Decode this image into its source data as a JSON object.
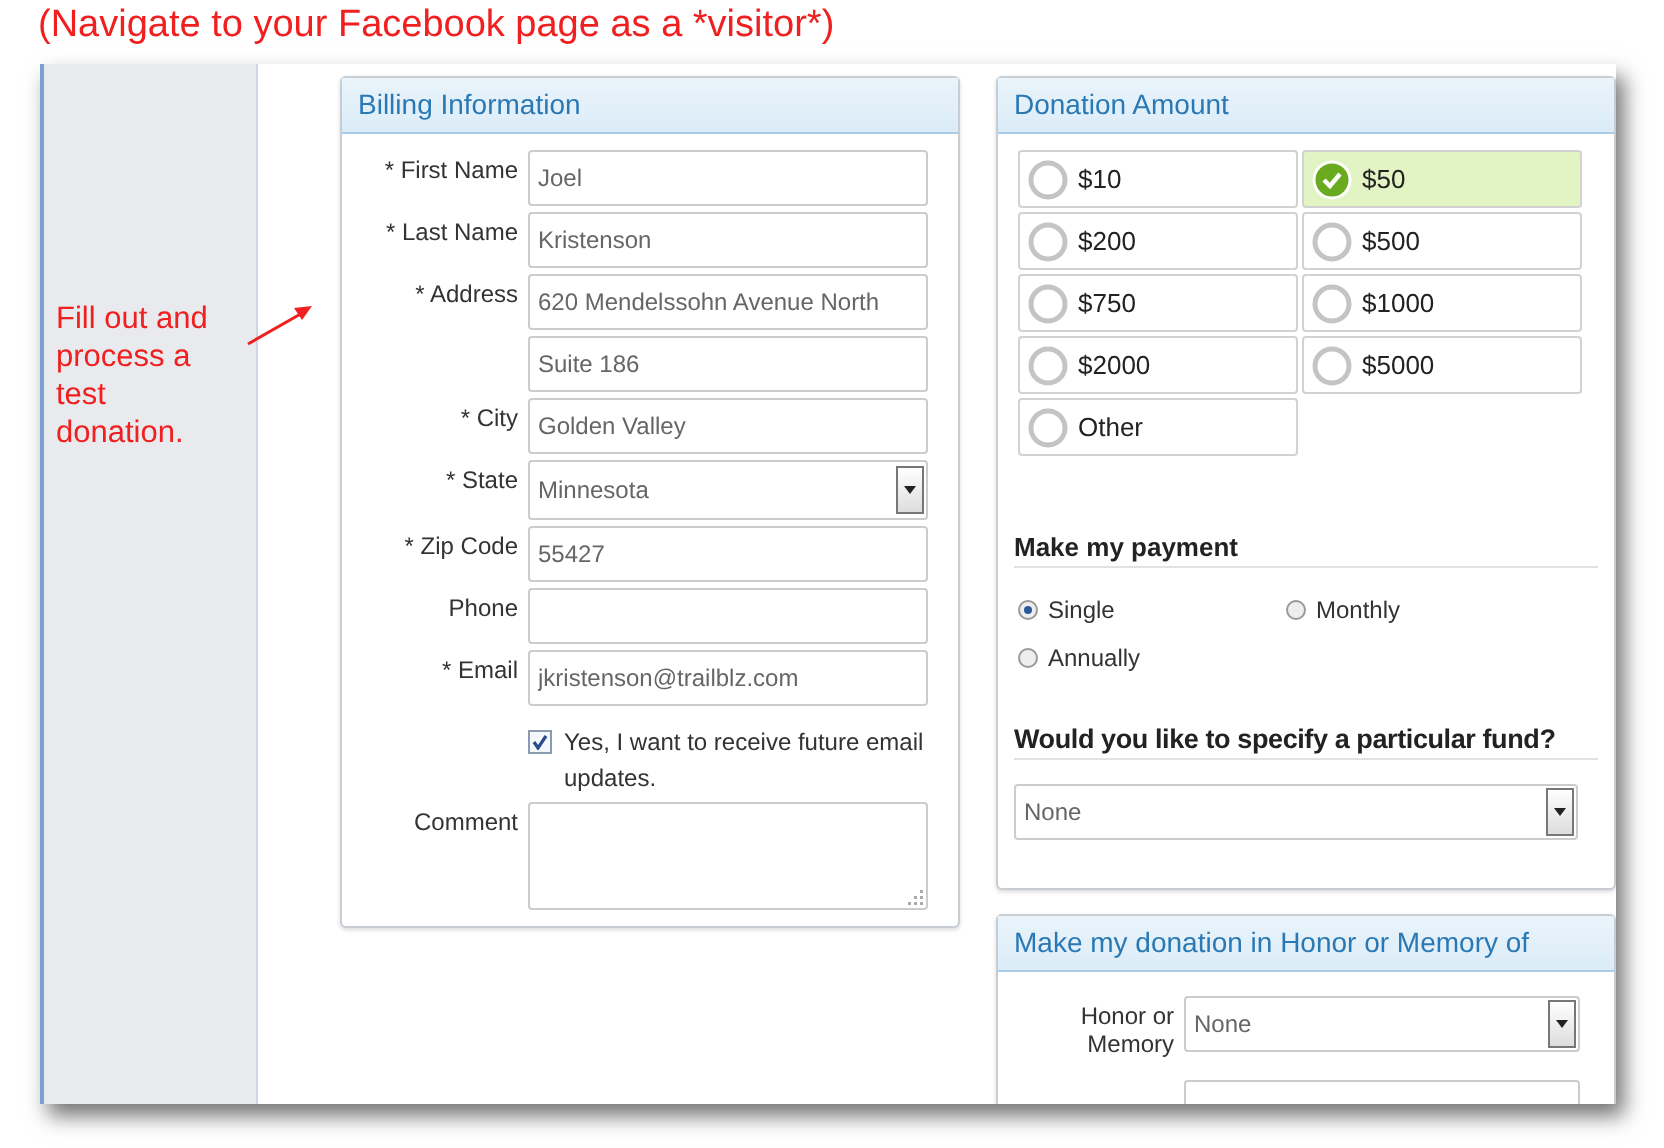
{
  "caption": "(Navigate to your Facebook page as a *visitor*)",
  "annotation": {
    "text": "Fill out and process a test donation."
  },
  "billing": {
    "title": "Billing Information",
    "fields": [
      {
        "label": "* First Name",
        "kind": "text",
        "value": "Joel"
      },
      {
        "label": "* Last Name",
        "kind": "text",
        "value": "Kristenson"
      },
      {
        "label": "* Address",
        "kind": "text",
        "value": "620 Mendelssohn Avenue North"
      },
      {
        "kind": "text",
        "value": "Suite 186"
      },
      {
        "label": "* City",
        "kind": "text",
        "value": "Golden Valley"
      },
      {
        "label": "* State",
        "kind": "select",
        "value": "Minnesota"
      },
      {
        "label": "* Zip Code",
        "kind": "text",
        "value": "55427"
      },
      {
        "label": "Phone",
        "kind": "text"
      },
      {
        "label": "* Email",
        "kind": "text",
        "value": "jkristenson@trailblz.com"
      }
    ],
    "updates": {
      "label": "Yes, I want to receive future email updates.",
      "checked": true
    },
    "comment": {
      "label": "Comment"
    }
  },
  "donation": {
    "title": "Donation Amount",
    "amounts": [
      {
        "label": "$10",
        "selected": false
      },
      {
        "label": "$50",
        "selected": true
      },
      {
        "label": "$200",
        "selected": false
      },
      {
        "label": "$500",
        "selected": false
      },
      {
        "label": "$750",
        "selected": false
      },
      {
        "label": "$1000",
        "selected": false
      },
      {
        "label": "$2000",
        "selected": false
      },
      {
        "label": "$5000",
        "selected": false
      },
      {
        "label": "Other",
        "selected": false
      }
    ],
    "payment": {
      "title": "Make my payment",
      "options": [
        {
          "label": "Single",
          "selected": true
        },
        {
          "label": "Monthly",
          "selected": false
        },
        {
          "label": "Annually",
          "selected": false
        }
      ]
    },
    "fund": {
      "title": "Would you like to specify a particular fund?",
      "value": "None"
    }
  },
  "honor": {
    "title": "Make my donation in Honor or Memory of",
    "fields": [
      {
        "label": "Honor or Memory",
        "kind": "select",
        "value": "None"
      },
      {
        "kind": "text"
      }
    ]
  }
}
